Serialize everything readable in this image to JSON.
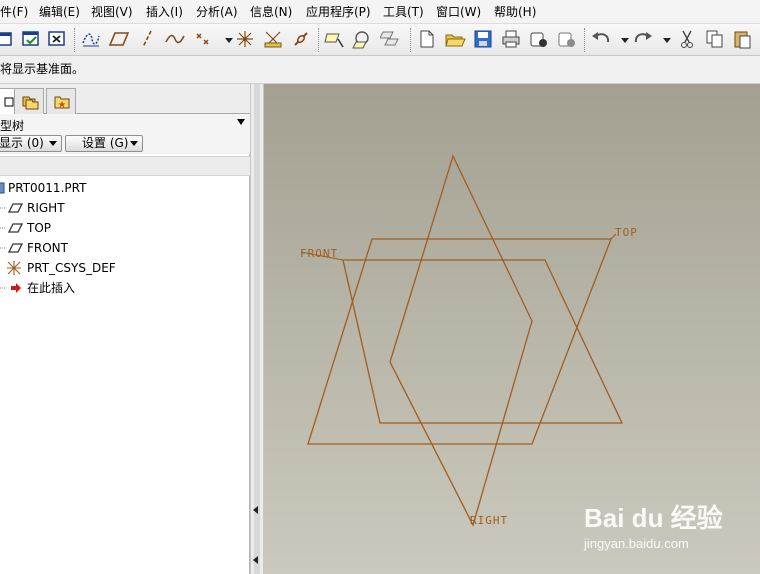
{
  "menubar": {
    "items": [
      "件(F)",
      "编辑(E)",
      "视图(V)",
      "插入(I)",
      "分析(A)",
      "信息(N)",
      "应用程序(P)",
      "工具(T)",
      "窗口(W)",
      "帮助(H)"
    ]
  },
  "toolbar": {
    "icons": [
      "regenerate-icon",
      "window-activate-icon",
      "close-window-icon",
      "sketch-curve-icon",
      "datum-plane-icon",
      "datum-axis-icon",
      "datum-curve-icon",
      "datum-point-icon",
      "coordinate-system-icon",
      "analysis-icon",
      "link-icon",
      "sketch-tool-icon",
      "repaint-icon",
      "orient-icon",
      "new-file-icon",
      "open-file-icon",
      "save-icon",
      "print-icon",
      "email-icon",
      "email-link-icon",
      "undo-icon",
      "redo-icon",
      "cut-icon",
      "copy-icon",
      "paste-icon"
    ]
  },
  "message": {
    "text": "将显示基准面。"
  },
  "navigator": {
    "tabs": [
      "model-tree-tab-icon",
      "layers-tab-icon",
      "favorites-tab-icon"
    ],
    "title": "型树",
    "show_button": "显示 (0)",
    "settings_button": "设置 (G)",
    "tree": [
      {
        "label": "PRT0011.PRT",
        "icon": "part-icon"
      },
      {
        "label": "RIGHT",
        "icon": "datum-plane-icon"
      },
      {
        "label": "TOP",
        "icon": "datum-plane-icon"
      },
      {
        "label": "FRONT",
        "icon": "datum-plane-icon"
      },
      {
        "label": "PRT_CSYS_DEF",
        "icon": "coordinate-system-icon"
      },
      {
        "label": "在此插入",
        "icon": "insert-here-arrow-icon"
      }
    ]
  },
  "graphics": {
    "datum_labels": {
      "front": "FRONT",
      "top": "TOP",
      "right": "RIGHT"
    },
    "datum_color": "#a15d1f",
    "background_top": "#a3a092",
    "background_bottom": "#cbc8bd"
  },
  "watermark": {
    "logo": "Bai du 经验",
    "url": "jingyan.baidu.com"
  }
}
